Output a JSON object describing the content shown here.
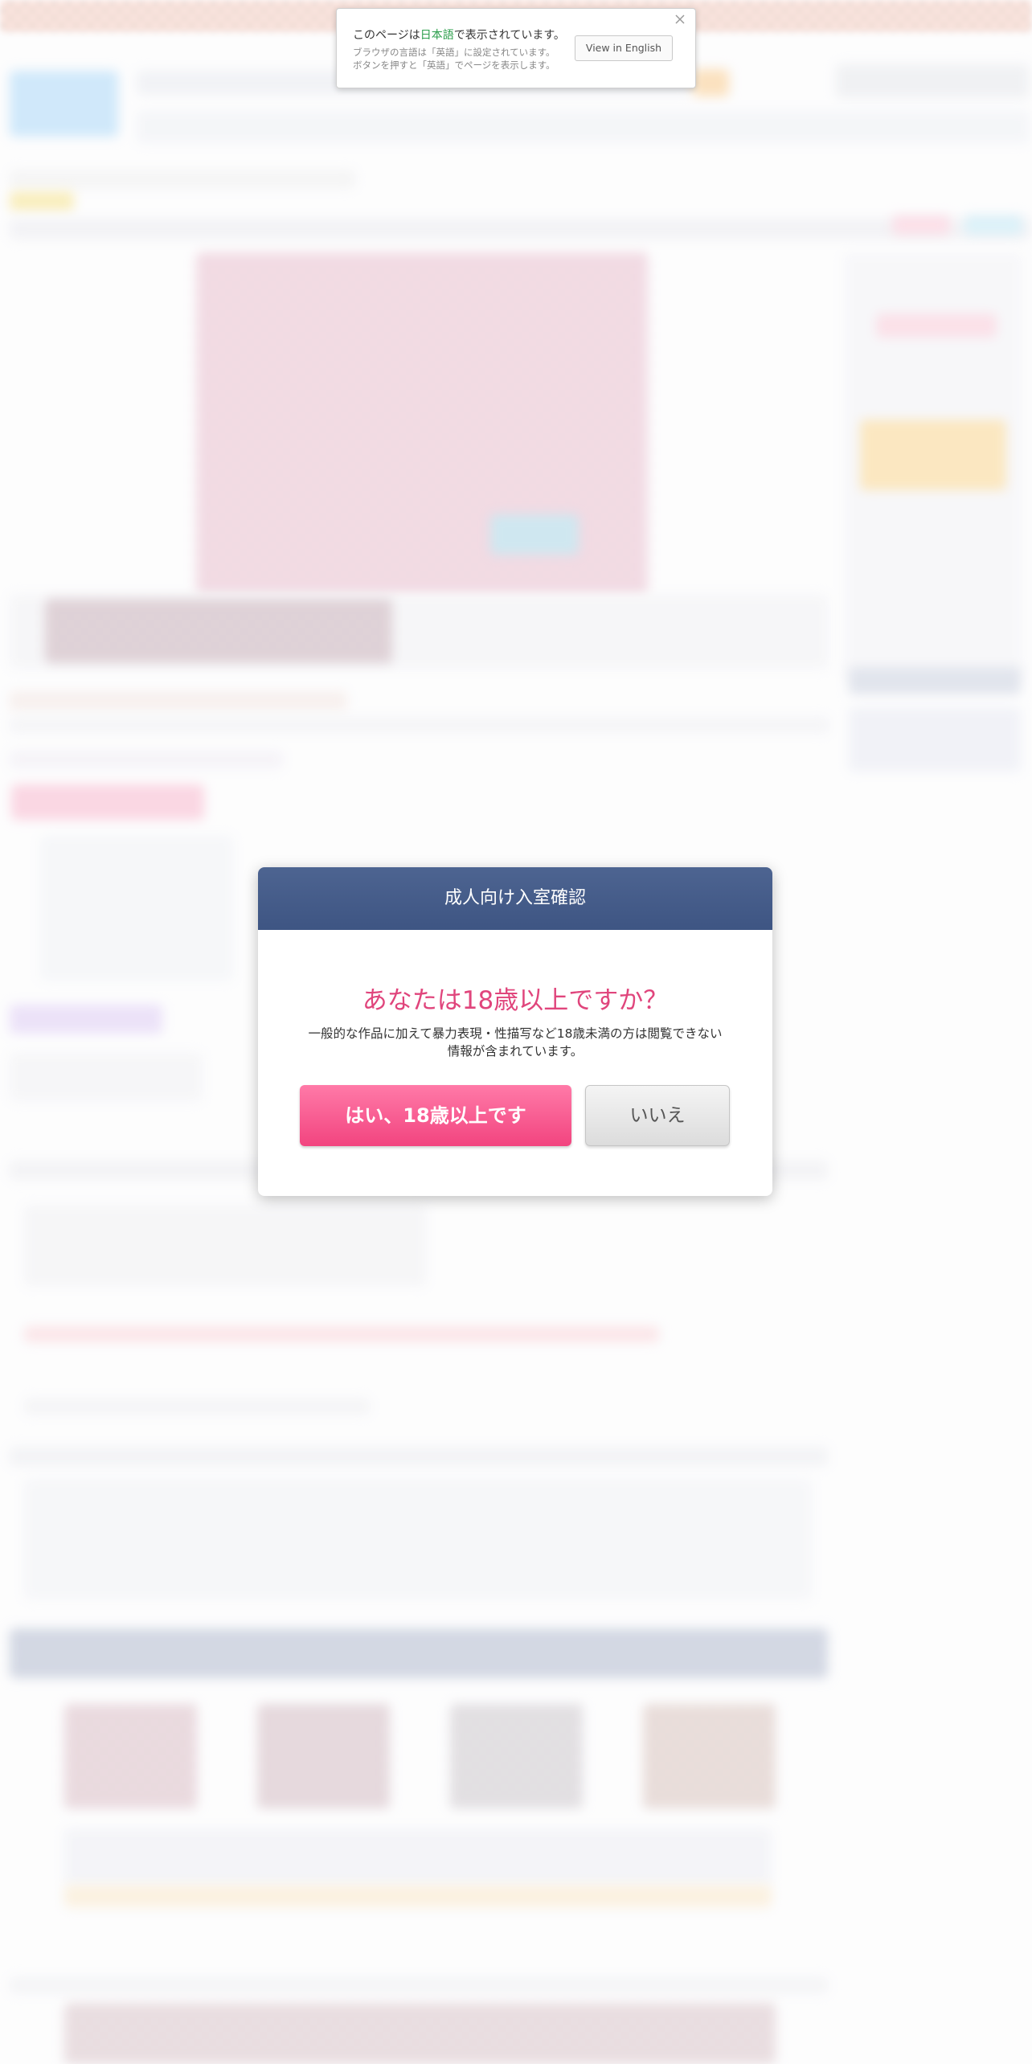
{
  "language_notice": {
    "line1_prefix": "このページは",
    "line1_language": "日本語",
    "line1_suffix": "で表示されています。",
    "line2": "ブラウザの言語は「英語」に設定されています。",
    "line3": "ボタンを押すと「英語」でページを表示します。",
    "view_button": "View in English",
    "close_icon": "close-icon"
  },
  "age_modal": {
    "title": "成人向け入室確認",
    "question": "あなたは18歳以上ですか？",
    "description": "一般的な作品に加えて暴力表現・性描写など18歳未満の方は閲覧できない情報が含まれています。",
    "yes_button": "はい、18歳以上です",
    "no_button": "いいえ"
  },
  "colors": {
    "modal_header": "#445a88",
    "accent_pink": "#e0457c",
    "yes_button": "#f5588c",
    "highlight_green": "#2a9d4a"
  }
}
